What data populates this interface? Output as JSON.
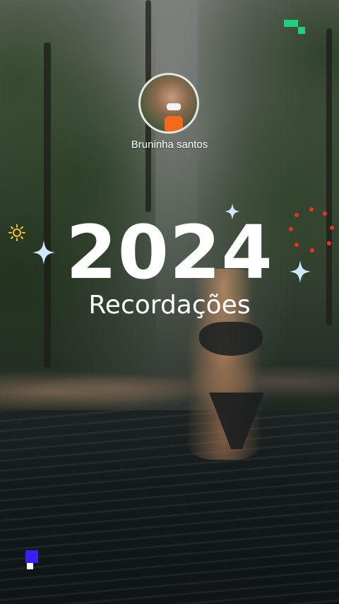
{
  "profile": {
    "name": "Bruninha santos",
    "avatar_icon": "profile-photo"
  },
  "title": {
    "year": "2024",
    "subtitle": "Recordações"
  },
  "decor": {
    "sparkle_color": "#cfe8ff",
    "sun_color": "#f2c230",
    "dots_color": "#e8322a",
    "pixel_green": "#21d07a",
    "pixel_blue": "#3a1ff0"
  }
}
